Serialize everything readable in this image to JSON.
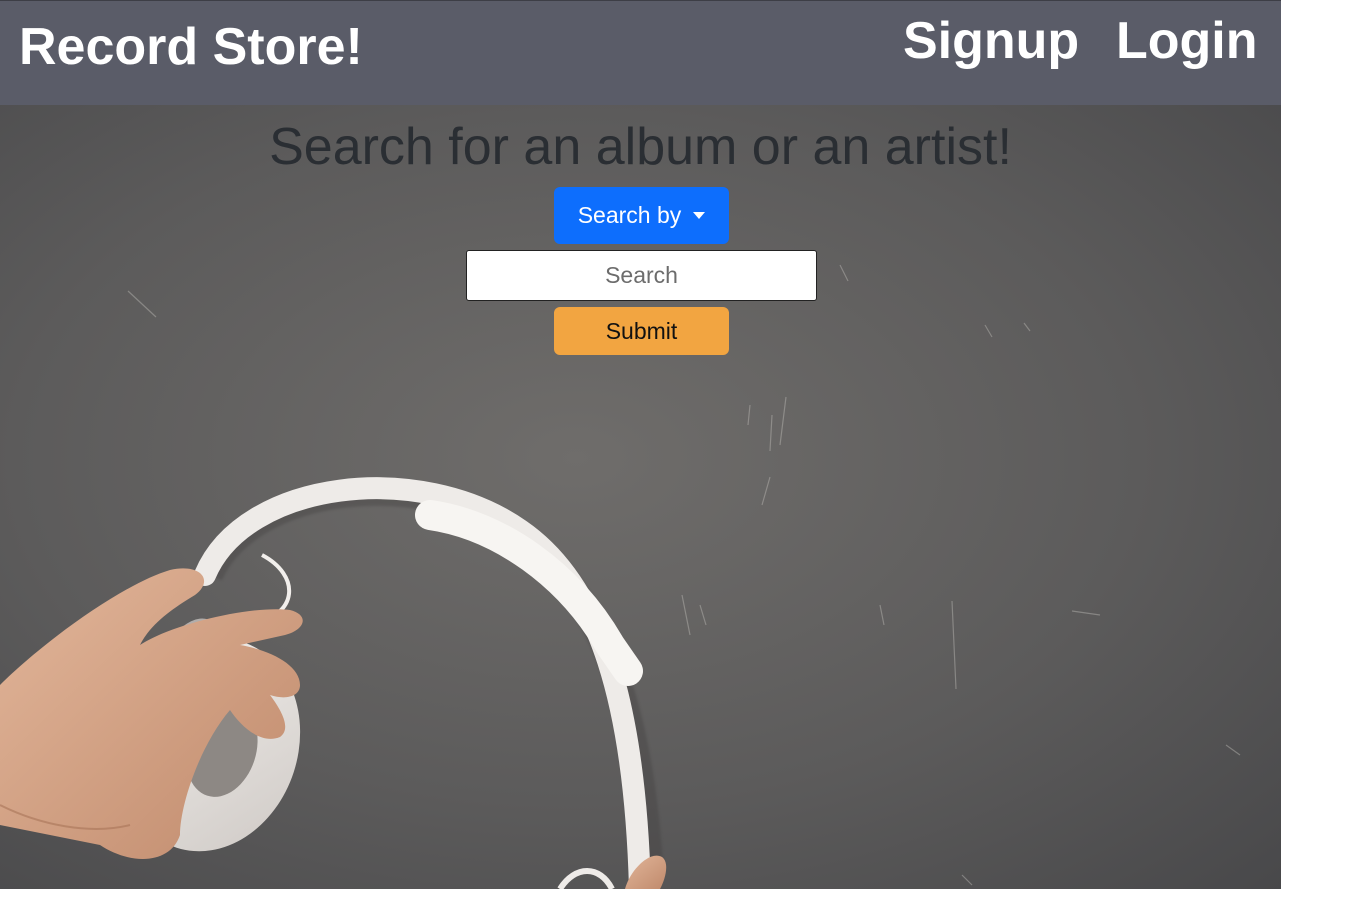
{
  "navbar": {
    "brand": "Record Store!",
    "links": [
      {
        "label": "Signup"
      },
      {
        "label": "Login"
      }
    ]
  },
  "hero": {
    "title": "Search for an album or an artist!",
    "search_by_label": "Search by",
    "search_placeholder": "Search",
    "search_value": "",
    "submit_label": "Submit",
    "background_image": "hand-holding-white-headphones-on-chalkboard"
  },
  "colors": {
    "navbar_bg": "#5a5c68",
    "primary_button": "#0d6efd",
    "submit_button": "#f2a541",
    "chalkboard": "#5e5e60"
  }
}
